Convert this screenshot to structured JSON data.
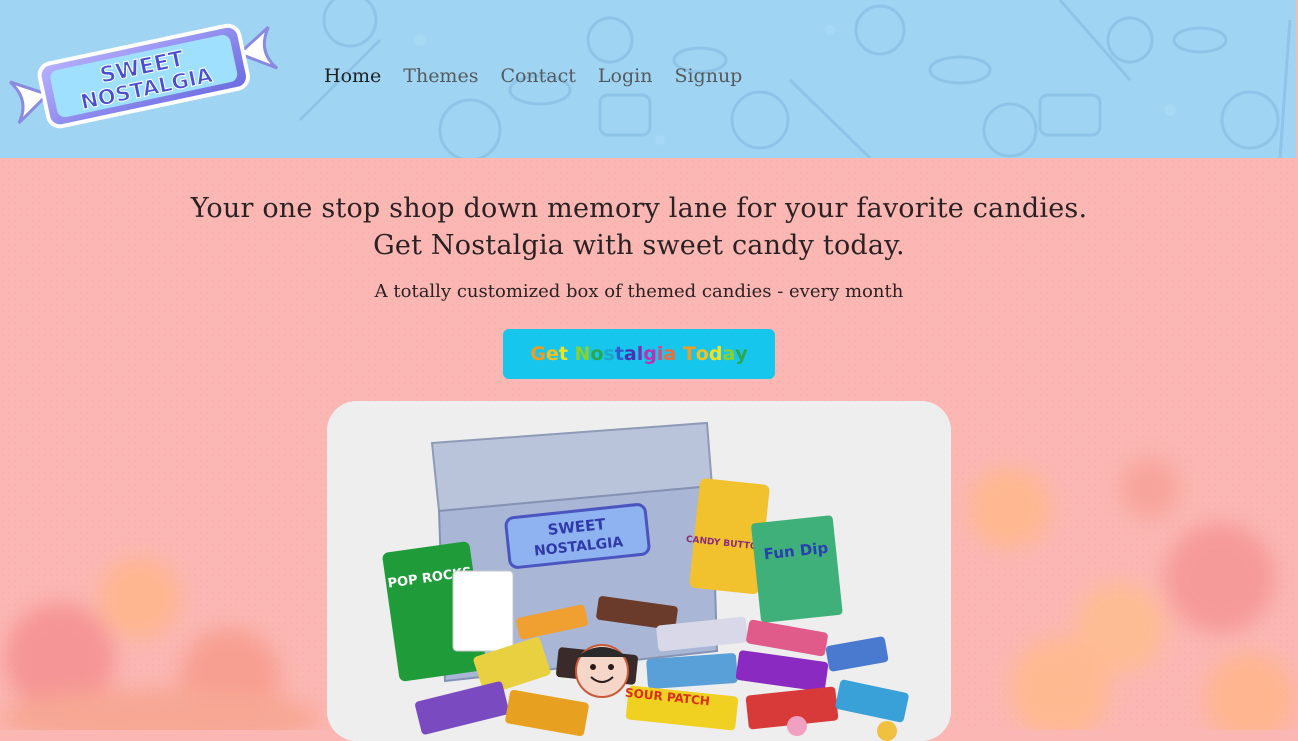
{
  "brand": {
    "logo_line1": "SWEET",
    "logo_line2": "NOSTALGIA"
  },
  "nav": {
    "items": [
      {
        "label": "Home",
        "active": true
      },
      {
        "label": "Themes",
        "active": false
      },
      {
        "label": "Contact",
        "active": false
      },
      {
        "label": "Login",
        "active": false
      },
      {
        "label": "Signup",
        "active": false
      }
    ]
  },
  "hero": {
    "title_line1": "Your one stop shop down memory lane for your favorite candies.",
    "title_line2": "Get Nostalgia with sweet candy today.",
    "subtitle": "A totally customized box of themed candies - every month",
    "cta_label": "Get Nostalgia Today"
  },
  "photo": {
    "box_logo_line1": "SWEET",
    "box_logo_line2": "NOSTALGIA",
    "packets": [
      "POP ROCKS",
      "CANDY BUTTONS",
      "Fun Dip",
      "SOUR PATCH"
    ]
  },
  "colors": {
    "header_bg": "#9fd4f2",
    "page_bg": "#fbb7b3",
    "cta_bg": "#17c6ec",
    "rainbow": [
      "#f29b1f",
      "#f2c11f",
      "#f5e21b",
      "#8bd12a",
      "#2aa84a",
      "#1fa6c8",
      "#2f5fcf",
      "#4a2fb0",
      "#7a2fb0",
      "#c02fb0",
      "#e0457a",
      "#f06a3a",
      "#f29b1f",
      "#f2c11f",
      "#f5e21b",
      "#8bd12a",
      "#2aa84a",
      "#1fa6c8",
      "#7a2fb0"
    ]
  }
}
